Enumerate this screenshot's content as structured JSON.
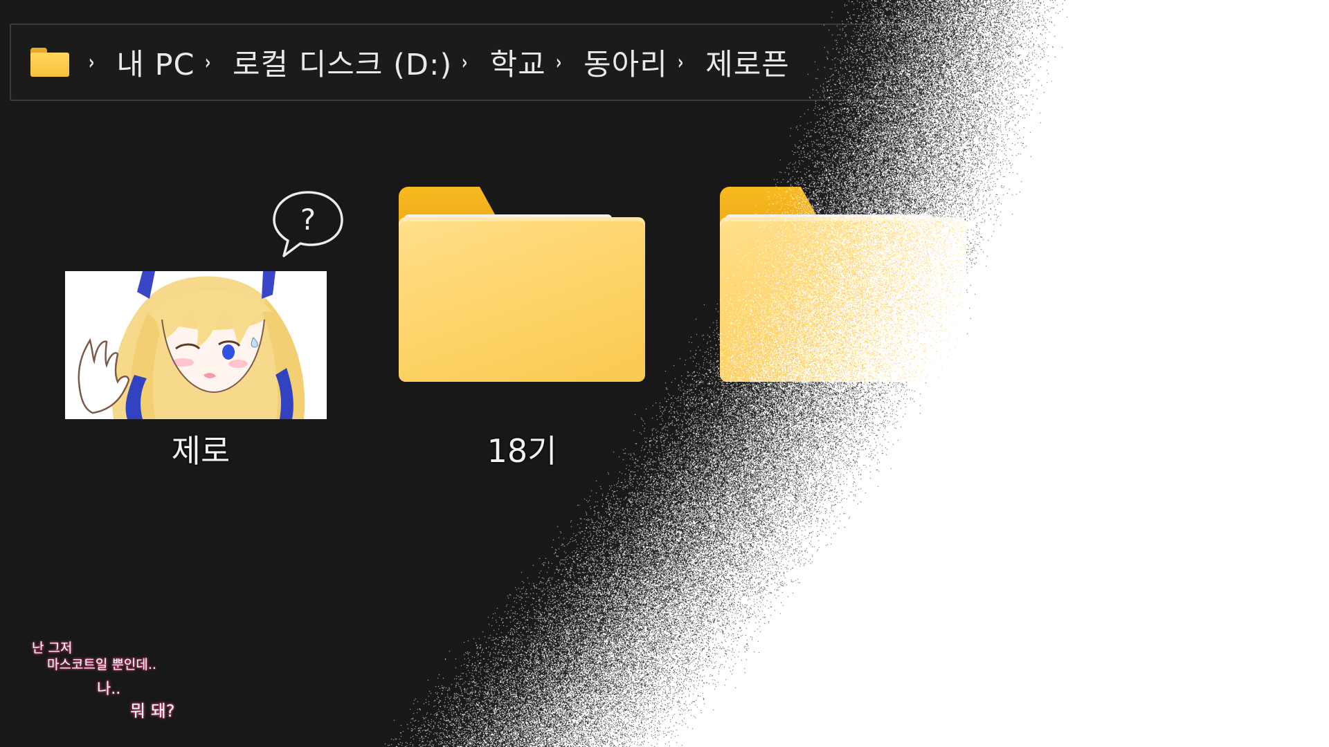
{
  "breadcrumb": {
    "root_icon": "folder-icon",
    "separator": "›",
    "items": [
      "내 PC",
      "로컬 디스크 (D:)",
      "학교",
      "동아리",
      "제로픈"
    ]
  },
  "files": [
    {
      "name": "제로",
      "type": "image",
      "icon": "character-thumbnail"
    },
    {
      "name": "18기",
      "type": "folder",
      "icon": "folder-icon"
    },
    {
      "name": "",
      "type": "folder",
      "icon": "folder-icon"
    }
  ],
  "bubble": {
    "text": "?"
  },
  "monologue": {
    "line1": "난 그저",
    "line2": "마스코트일 뿐인데..",
    "line3": "나..",
    "line4": "뭐 돼?"
  },
  "colors": {
    "background": "#181818",
    "folder": "#ffd670",
    "folder_tab": "#f4b11c",
    "fade": "#ffffff",
    "text_glow": "#ff5a8a"
  }
}
